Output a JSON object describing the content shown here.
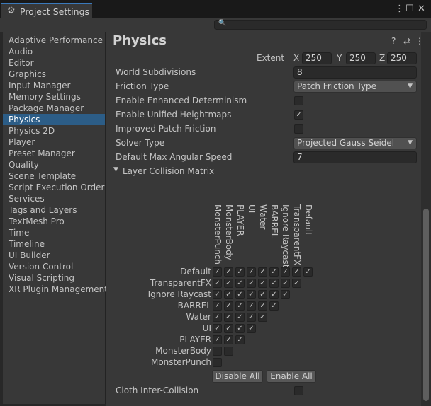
{
  "window": {
    "tab_title": "Project Settings",
    "icons": {
      "gear": "⚙",
      "more": "⋮",
      "maximize": "☐",
      "close": "✕",
      "search": "🔍"
    }
  },
  "sidebar": {
    "items": [
      {
        "label": "Adaptive Performance"
      },
      {
        "label": "Audio"
      },
      {
        "label": "Editor"
      },
      {
        "label": "Graphics"
      },
      {
        "label": "Input Manager"
      },
      {
        "label": "Memory Settings"
      },
      {
        "label": "Package Manager"
      },
      {
        "label": "Physics",
        "selected": true
      },
      {
        "label": "Physics 2D"
      },
      {
        "label": "Player"
      },
      {
        "label": "Preset Manager"
      },
      {
        "label": "Quality"
      },
      {
        "label": "Scene Template"
      },
      {
        "label": "Script Execution Order"
      },
      {
        "label": "Services"
      },
      {
        "label": "Tags and Layers"
      },
      {
        "label": "TextMesh Pro"
      },
      {
        "label": "Time"
      },
      {
        "label": "Timeline"
      },
      {
        "label": "UI Builder"
      },
      {
        "label": "Version Control"
      },
      {
        "label": "Visual Scripting"
      },
      {
        "label": "XR Plugin Management"
      }
    ]
  },
  "content": {
    "title": "Physics",
    "header_icons": {
      "help": "?",
      "preset": "⇄",
      "more": "⋮"
    },
    "extent": {
      "label": "Extent",
      "x_label": "X",
      "x": "250",
      "y_label": "Y",
      "y": "250",
      "z_label": "Z",
      "z": "250"
    },
    "world_subdivisions": {
      "label": "World Subdivisions",
      "value": "8"
    },
    "friction_type": {
      "label": "Friction Type",
      "value": "Patch Friction Type"
    },
    "enhanced_determinism": {
      "label": "Enable Enhanced Determinism",
      "checked": false
    },
    "unified_heightmaps": {
      "label": "Enable Unified Heightmaps",
      "checked": true
    },
    "improved_patch_friction": {
      "label": "Improved Patch Friction",
      "checked": false
    },
    "solver_type": {
      "label": "Solver Type",
      "value": "Projected Gauss Seidel"
    },
    "max_angular_speed": {
      "label": "Default Max Angular Speed",
      "value": "7"
    },
    "matrix": {
      "label": "Layer Collision Matrix",
      "foldout": "▼",
      "check": "✓",
      "layers": [
        "Default",
        "TransparentFX",
        "Ignore Raycast",
        "BARREL",
        "Water",
        "UI",
        "PLAYER",
        "MonsterBody",
        "MonsterPunch"
      ],
      "columns": [
        "MonsterPunch",
        "MonsterBody",
        "PLAYER",
        "UI",
        "Water",
        "BARREL",
        "Ignore Raycast",
        "TransparentFX",
        "Default"
      ],
      "cells": [
        [
          true,
          true,
          true,
          true,
          true,
          true,
          true,
          true,
          true
        ],
        [
          true,
          true,
          true,
          true,
          true,
          true,
          true,
          true
        ],
        [
          true,
          true,
          true,
          true,
          true,
          true,
          true
        ],
        [
          true,
          true,
          true,
          true,
          true,
          true
        ],
        [
          true,
          true,
          true,
          true,
          true
        ],
        [
          true,
          true,
          true,
          true
        ],
        [
          true,
          true,
          true
        ],
        [
          false,
          false
        ],
        [
          false
        ]
      ],
      "disable_all": "Disable All",
      "enable_all": "Enable All"
    },
    "cloth_inter_collision": {
      "label": "Cloth Inter-Collision",
      "checked": false
    }
  }
}
